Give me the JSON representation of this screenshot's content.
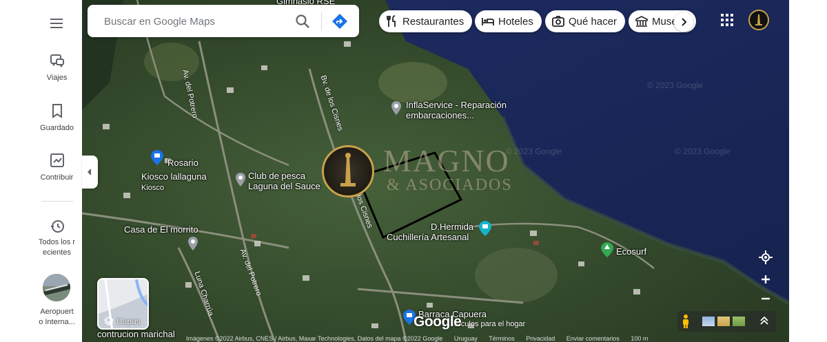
{
  "search": {
    "placeholder": "Buscar en Google Maps"
  },
  "chips": [
    {
      "label": "Restaurantes",
      "icon": "fork-knife-icon"
    },
    {
      "label": "Hoteles",
      "icon": "bed-icon"
    },
    {
      "label": "Qué hacer",
      "icon": "camera-icon"
    },
    {
      "label": "Muse",
      "icon": "museum-icon"
    }
  ],
  "rail": {
    "items": [
      {
        "label": "Viajes",
        "icon": "commute-icon"
      },
      {
        "label": "Guardado",
        "icon": "bookmark-icon"
      },
      {
        "label": "Contribuir",
        "icon": "contribute-icon"
      },
      {
        "label": "Todos los r",
        "label2": "ecientes",
        "icon": "history-icon"
      },
      {
        "label": "Aeropuert",
        "label2": "o Interna...",
        "icon": "recent-place-thumbnail"
      }
    ]
  },
  "map": {
    "labels": [
      {
        "text": "InflaService - Reparación",
        "text2": "embarcaciones..."
      },
      {
        "text": "Rosario"
      },
      {
        "text": "Kiosco lallaguna",
        "text2": "Kiosco"
      },
      {
        "text": "Club de pesca",
        "text2": "Laguna del Sauce"
      },
      {
        "text": "Casa de  El morrito"
      },
      {
        "text": "D.Hermida",
        "text2": "Cuchillería Artesanal"
      },
      {
        "text": "Ecosurf"
      },
      {
        "text": "Barraca Capuera"
      },
      {
        "text": "contrucion marichal"
      },
      {
        "text": "Gimnasio RSE"
      }
    ],
    "roads": [
      "Av. del Potrero",
      "Bv. de los Cisnes",
      "Bv. de los Cisnes",
      "Av. del Potrero",
      "Luna Charrúa"
    ],
    "watermarks": [
      "© 2023 Google",
      "© 2023 Google",
      "© 2023 Google"
    ],
    "brand": {
      "main": "MAGNO",
      "sub": "& ASOCIADOS"
    },
    "hogar_text": "rtículos para el hogar"
  },
  "controls": {
    "layers_label": "Capas",
    "google_logo": "Google"
  },
  "footer": {
    "attribution": "Imágenes ©2022 Airbus, CNES / Airbus, Maxar Technologies, Datos del mapa ©2022 Google",
    "country": "Uruguay",
    "terms": "Términos",
    "privacy": "Privacidad",
    "feedback": "Enviar comentarios",
    "scale": "100 m"
  },
  "colors": {
    "water": "#1b2a5c",
    "accent_blue": "#1a73e8",
    "gold": "#c9a24b"
  }
}
